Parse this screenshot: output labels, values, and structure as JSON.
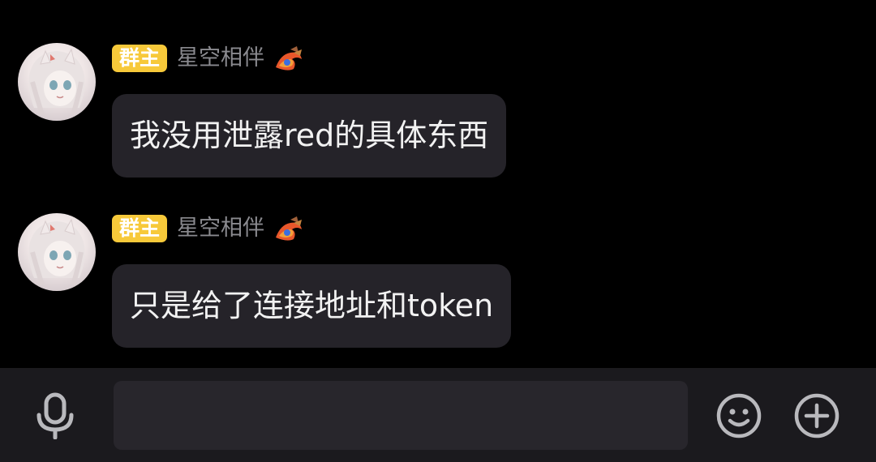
{
  "messages": [
    {
      "badge": "群主",
      "sender": "星空相伴",
      "text": "我没用泄露red的具体东西",
      "medal_icon": "dragon-medal-icon"
    },
    {
      "badge": "群主",
      "sender": "星空相伴",
      "text": "只是给了连接地址和token",
      "medal_icon": "dragon-medal-icon"
    }
  ],
  "input": {
    "value": "",
    "mic_icon": "microphone-icon",
    "emoji_icon": "emoji-smile-icon",
    "plus_icon": "plus-circle-icon"
  },
  "colors": {
    "background": "#000000",
    "bubble": "#252329",
    "badge": "#f7c93a",
    "sender": "#8a8a8f",
    "bottom_bar": "#1b1a1e",
    "input_bg": "#28262c",
    "icon": "#b9b9bd"
  }
}
